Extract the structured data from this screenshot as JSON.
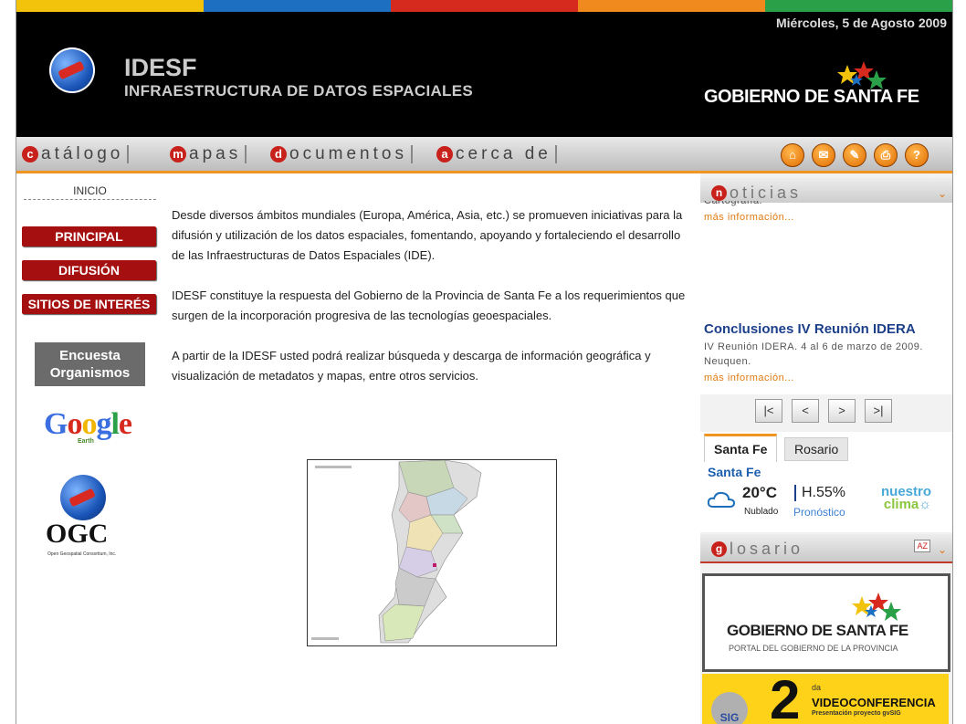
{
  "header": {
    "date": "Miércoles, 5 de Agosto 2009",
    "logo_title": "IDESF",
    "logo_subtitle": "INFRAESTRUCTURA DE DATOS ESPACIALES",
    "gobierno": "GOBIERNO DE SANTA FE"
  },
  "colors": {
    "bar": [
      "#f2c30a",
      "#1d6fc2",
      "#d62a1e",
      "#f08a1e",
      "#2aa148"
    ]
  },
  "nav": {
    "items": [
      {
        "cap": "c",
        "rest": "atálogo"
      },
      {
        "cap": "m",
        "rest": "apas"
      },
      {
        "cap": "d",
        "rest": "ocumentos"
      },
      {
        "cap": "a",
        "rest": "cerca de"
      }
    ],
    "icons": [
      "home-icon",
      "mail-icon",
      "edit-icon",
      "print-icon",
      "help-icon"
    ]
  },
  "sidebar": {
    "inicio": "INICIO",
    "buttons": [
      "PRINCIPAL",
      "DIFUSIÓN",
      "SITIOS DE INTERÉS"
    ],
    "encuesta": "Encuesta Organismos",
    "google": "Google",
    "google_sub": "Earth",
    "ogc": "OGC",
    "ogc_sub": "Open Geospatial Consortium, Inc."
  },
  "main": {
    "p1": "Desde diversos ámbitos mundiales (Europa, América, Asia, etc.) se promueven iniciativas para la difusión y utilización de los datos espaciales, fomentando, apoyando y fortaleciendo el desarrollo de las Infraestructuras de Datos Espaciales (IDE).",
    "p2": "IDESF constituye la respuesta del Gobierno de la Provincia de Santa Fe a los requerimientos que surgen de la incorporación progresiva de las tecnologías geoespaciales.",
    "p3": "A partir de la IDESF usted podrá realizar búsqueda y descarga de información geográfica y visualización de metadatos y mapas, entre otros servicios."
  },
  "noticias": {
    "cap": "n",
    "rest": "oticias",
    "cut_text": "Cartografía.",
    "link1": "más información...",
    "title": "Conclusiones IV Reunión IDERA",
    "text": "IV Reunión IDERA. 4 al 6 de marzo de 2009. Neuquen.",
    "link2": "más información...",
    "pager": [
      "|<",
      "<",
      ">",
      ">|"
    ]
  },
  "weather": {
    "tab_active": "Santa Fe",
    "tab_inactive": "Rosario",
    "city": "Santa Fe",
    "temp": "20°C",
    "humidity": "H.55%",
    "condition": "Nublado",
    "forecast": "Pronóstico",
    "brand1": "nuestro",
    "brand2": "clima"
  },
  "glosario": {
    "cap": "g",
    "rest": "losario",
    "badge": "AZ",
    "gob": "GOBIERNO DE SANTA FE",
    "gob_sub": "PORTAL DEL GOBIERNO DE LA PROVINCIA"
  },
  "video": {
    "sig": "SIG",
    "num": "2",
    "da": "da",
    "title": "VIDEOCONFERENCIA",
    "subtitle": "Presentación proyecto gvSIG"
  }
}
